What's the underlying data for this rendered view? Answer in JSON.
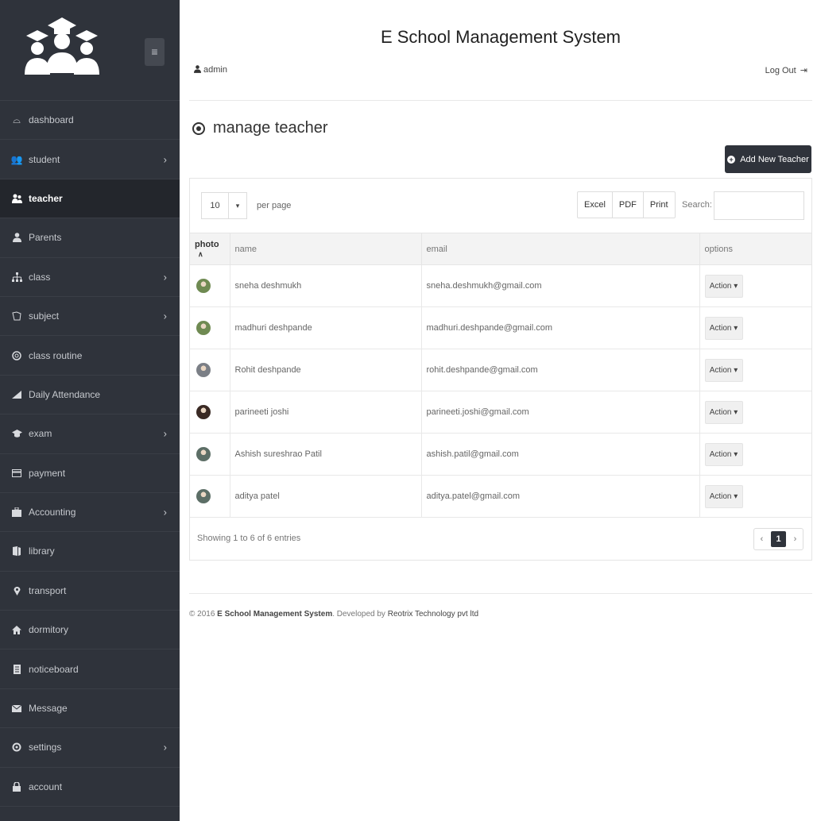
{
  "app": {
    "title": "E School Management System",
    "user": "admin",
    "logout": "Log Out"
  },
  "sidebar": {
    "items": [
      {
        "label": "dashboard",
        "icon": "dashboard-icon",
        "arrow": false,
        "active": false
      },
      {
        "label": "student",
        "icon": "students-icon",
        "arrow": true,
        "active": false
      },
      {
        "label": "teacher",
        "icon": "teacher-icon",
        "arrow": false,
        "active": true
      },
      {
        "label": "Parents",
        "icon": "user-icon",
        "arrow": false,
        "active": false
      },
      {
        "label": "class",
        "icon": "sitemap-icon",
        "arrow": true,
        "active": false
      },
      {
        "label": "subject",
        "icon": "book-icon",
        "arrow": true,
        "active": false
      },
      {
        "label": "class routine",
        "icon": "life-ring-icon",
        "arrow": false,
        "active": false
      },
      {
        "label": "Daily Attendance",
        "icon": "chart-icon",
        "arrow": false,
        "active": false
      },
      {
        "label": "exam",
        "icon": "graduation-cap-icon",
        "arrow": true,
        "active": false
      },
      {
        "label": "payment",
        "icon": "credit-card-icon",
        "arrow": false,
        "active": false
      },
      {
        "label": "Accounting",
        "icon": "briefcase-icon",
        "arrow": true,
        "active": false
      },
      {
        "label": "library",
        "icon": "book-open-icon",
        "arrow": false,
        "active": false
      },
      {
        "label": "transport",
        "icon": "map-marker-icon",
        "arrow": false,
        "active": false
      },
      {
        "label": "dormitory",
        "icon": "home-icon",
        "arrow": false,
        "active": false
      },
      {
        "label": "noticeboard",
        "icon": "clipboard-icon",
        "arrow": false,
        "active": false
      },
      {
        "label": "Message",
        "icon": "envelope-icon",
        "arrow": false,
        "active": false
      },
      {
        "label": "settings",
        "icon": "gear-icon",
        "arrow": true,
        "active": false
      },
      {
        "label": "account",
        "icon": "lock-icon",
        "arrow": false,
        "active": false
      }
    ]
  },
  "page": {
    "title": "manage teacher",
    "add_button": "Add New Teacher"
  },
  "table": {
    "per_page_value": "10",
    "per_page_label": "per page",
    "export_buttons": [
      "Excel",
      "PDF",
      "Print"
    ],
    "search_label": "Search:",
    "columns": {
      "photo": "photo",
      "name": "name",
      "email": "email",
      "options": "options"
    },
    "rows": [
      {
        "name": "sneha deshmukh",
        "email": "sneha.deshmukh@gmail.com",
        "action": "Action",
        "avatar_color": "#6f8a52"
      },
      {
        "name": "madhuri deshpande",
        "email": "madhuri.deshpande@gmail.com",
        "action": "Action",
        "avatar_color": "#6f8a52"
      },
      {
        "name": "Rohit deshpande",
        "email": "rohit.deshpande@gmail.com",
        "action": "Action",
        "avatar_color": "#7b7f86"
      },
      {
        "name": "parineeti joshi",
        "email": "parineeti.joshi@gmail.com",
        "action": "Action",
        "avatar_color": "#3a2a24"
      },
      {
        "name": "Ashish sureshrao Patil",
        "email": "ashish.patil@gmail.com",
        "action": "Action",
        "avatar_color": "#5c6e66"
      },
      {
        "name": "aditya patel",
        "email": "aditya.patel@gmail.com",
        "action": "Action",
        "avatar_color": "#5c6e66"
      }
    ],
    "showing": "Showing 1 to 6 of 6 entries",
    "pagination": {
      "prev": "‹",
      "current": "1",
      "next": "›"
    }
  },
  "footer": {
    "prefix": "© 2016 ",
    "brand": "E School Management System",
    "middle": ". Developed by ",
    "company": "Reotrix Technology pvt ltd"
  },
  "colors": {
    "sidebar_bg": "#2f333b",
    "active_bg": "#23262c",
    "button_dark": "#2f333b"
  }
}
